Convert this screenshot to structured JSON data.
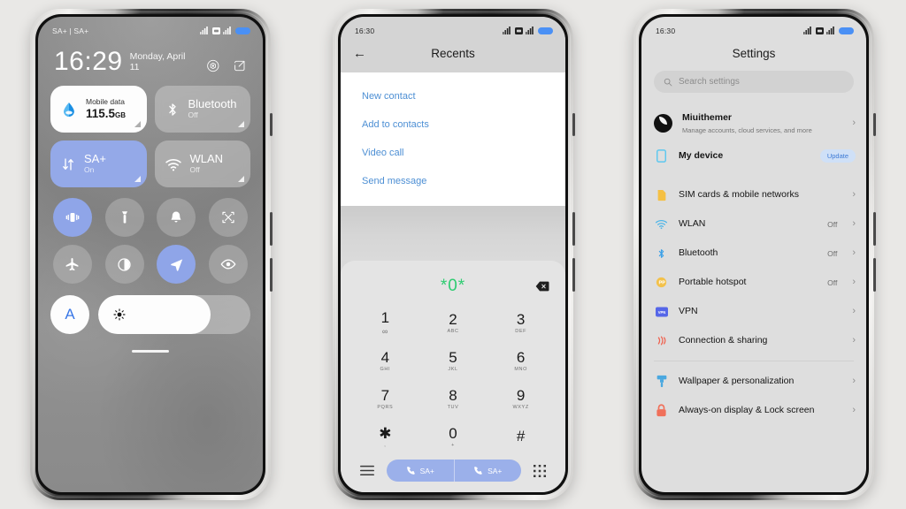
{
  "background_color": "#e9e8e6",
  "accent_blue": "#8fa5e8",
  "link_blue": "#4d8fd4",
  "green_digits": "#2ecc71",
  "phone_left": {
    "name": "control-center",
    "statusbar": {
      "carrier": "SA+ | SA+",
      "icons": [
        "signal-icon",
        "dual-sim-icon",
        "signal-icon",
        "battery-icon"
      ]
    },
    "clock": {
      "time": "16:29",
      "date": "Monday, April 11"
    },
    "header_icons": [
      "settings-gear-icon",
      "edit-icon"
    ],
    "tiles": [
      {
        "name": "mobile-data",
        "title": "Mobile data",
        "value": "115.5",
        "unit": "GB",
        "style": "white",
        "icon": "water-drop-icon"
      },
      {
        "name": "bluetooth",
        "title": "Bluetooth",
        "status": "Off",
        "style": "gray",
        "icon": "bluetooth-icon"
      },
      {
        "name": "sa-plus",
        "title": "SA+",
        "status": "On",
        "style": "blue",
        "icon": "data-arrows-icon"
      },
      {
        "name": "wlan",
        "title": "WLAN",
        "status": "Off",
        "style": "gray",
        "icon": "wifi-icon"
      }
    ],
    "toggles": [
      {
        "name": "vibrate-toggle",
        "icon": "vibrate-icon",
        "on": true
      },
      {
        "name": "flashlight-toggle",
        "icon": "flashlight-icon",
        "on": false
      },
      {
        "name": "silent-toggle",
        "icon": "bell-icon",
        "on": false
      },
      {
        "name": "screenshot-toggle",
        "icon": "screenshot-icon",
        "on": false
      },
      {
        "name": "airplane-mode-toggle",
        "icon": "airplane-icon",
        "on": false
      },
      {
        "name": "dark-mode-toggle",
        "icon": "contrast-circle-icon",
        "on": false
      },
      {
        "name": "location-toggle",
        "icon": "location-arrow-icon",
        "on": true
      },
      {
        "name": "reading-mode-toggle",
        "icon": "eye-icon",
        "on": false
      }
    ],
    "brightness": {
      "auto_label": "A",
      "icon": "sun-icon",
      "level_percent": 74
    }
  },
  "phone_mid": {
    "name": "dialer-recents",
    "statusbar": {
      "time": "16:30",
      "icons": [
        "signal-icon",
        "dual-sim-icon",
        "signal-icon",
        "battery-icon"
      ]
    },
    "appbar": {
      "back_icon": "back-arrow-icon",
      "title": "Recents"
    },
    "menu_items": [
      {
        "name": "new-contact",
        "label": "New contact"
      },
      {
        "name": "add-to-contacts",
        "label": "Add to contacts"
      },
      {
        "name": "video-call",
        "label": "Video call"
      },
      {
        "name": "send-message",
        "label": "Send message"
      }
    ],
    "dialpad": {
      "display": "*0*",
      "backspace_icon": "backspace-icon",
      "keys": [
        {
          "digit": "1",
          "sub": "∞",
          "sub_kind": "voicemail"
        },
        {
          "digit": "2",
          "sub": "ABC"
        },
        {
          "digit": "3",
          "sub": "DEF"
        },
        {
          "digit": "4",
          "sub": "GHI"
        },
        {
          "digit": "5",
          "sub": "JKL"
        },
        {
          "digit": "6",
          "sub": "MNO"
        },
        {
          "digit": "7",
          "sub": "PQRS"
        },
        {
          "digit": "8",
          "sub": "TUV"
        },
        {
          "digit": "9",
          "sub": "WXYZ"
        },
        {
          "digit": "✱",
          "sub": ","
        },
        {
          "digit": "0",
          "sub": "+"
        },
        {
          "digit": "#",
          "sub": ""
        }
      ],
      "nav": {
        "menu_icon": "hamburger-menu-icon",
        "keypad_icon": "keypad-grid-icon",
        "call_buttons": [
          {
            "name": "call-sim1-button",
            "icon": "phone-icon",
            "label": "SA+"
          },
          {
            "name": "call-sim2-button",
            "icon": "phone-icon",
            "label": "SA+"
          }
        ]
      }
    }
  },
  "phone_right": {
    "name": "settings",
    "statusbar": {
      "time": "16:30",
      "icons": [
        "signal-icon",
        "dual-sim-icon",
        "signal-icon",
        "battery-icon"
      ]
    },
    "title": "Settings",
    "search": {
      "placeholder": "Search settings",
      "icon": "search-icon"
    },
    "account": {
      "name": "Miuithemer",
      "subtitle": "Manage accounts, cloud services, and more",
      "avatar": "user-avatar",
      "chevron": "chevron-right-icon"
    },
    "my_device": {
      "label": "My device",
      "badge": "Update",
      "icon": "phone-device-icon"
    },
    "items": [
      {
        "name": "sim-cards",
        "label": "SIM cards & mobile networks",
        "value": "",
        "icon": "sim-card-icon",
        "color": "#f5c044"
      },
      {
        "name": "wlan",
        "label": "WLAN",
        "value": "Off",
        "icon": "wifi-icon",
        "color": "#4fb6e8"
      },
      {
        "name": "bluetooth",
        "label": "Bluetooth",
        "value": "Off",
        "icon": "bluetooth-icon",
        "color": "#3aa0e8"
      },
      {
        "name": "portable-hotspot",
        "label": "Portable hotspot",
        "value": "Off",
        "icon": "hotspot-icon",
        "color": "#f3c14a"
      },
      {
        "name": "vpn",
        "label": "VPN",
        "value": "",
        "icon": "vpn-icon",
        "color": "#5566e8"
      },
      {
        "name": "connection-sharing",
        "label": "Connection & sharing",
        "value": "",
        "icon": "sharing-icon",
        "color": "#f0604d"
      }
    ],
    "items2": [
      {
        "name": "wallpaper-personalization",
        "label": "Wallpaper & personalization",
        "value": "",
        "icon": "brush-icon",
        "color": "#4aa8e0"
      },
      {
        "name": "always-on-display",
        "label": "Always-on display & Lock screen",
        "value": "",
        "icon": "lock-icon",
        "color": "#f0705a"
      }
    ]
  }
}
